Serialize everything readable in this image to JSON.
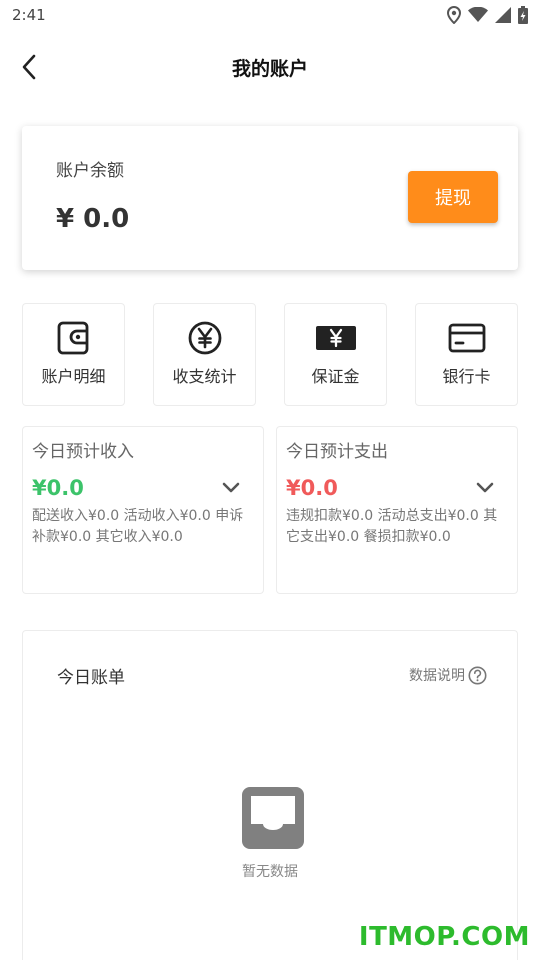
{
  "status_bar": {
    "time": "2:41"
  },
  "header": {
    "title": "我的账户"
  },
  "balance": {
    "label": "账户余额",
    "value": "¥ 0.0",
    "withdraw_label": "提现",
    "accent_color": "#ff8c1a"
  },
  "shortcuts": [
    {
      "label": "账户明细",
      "icon": "wallet-icon"
    },
    {
      "label": "收支统计",
      "icon": "yen-circle-icon"
    },
    {
      "label": "保证金",
      "icon": "yen-banknote-icon"
    },
    {
      "label": "银行卡",
      "icon": "bank-card-icon"
    }
  ],
  "income": {
    "title": "今日预计收入",
    "amount": "¥0.0",
    "detail": "配送收入¥0.0  活动收入¥0.0 申诉补款¥0.0 其它收入¥0.0",
    "color": "#3cc36a"
  },
  "expense": {
    "title": "今日预计支出",
    "amount": "¥0.0",
    "detail": "违规扣款¥0.0  活动总支出¥0.0 其它支出¥0.0 餐损扣款¥0.0",
    "color": "#f05a5a"
  },
  "bill": {
    "title": "今日账单",
    "data_explain": "数据说明",
    "empty_text": "暂无数据"
  },
  "watermark": "ITMOP.COM"
}
